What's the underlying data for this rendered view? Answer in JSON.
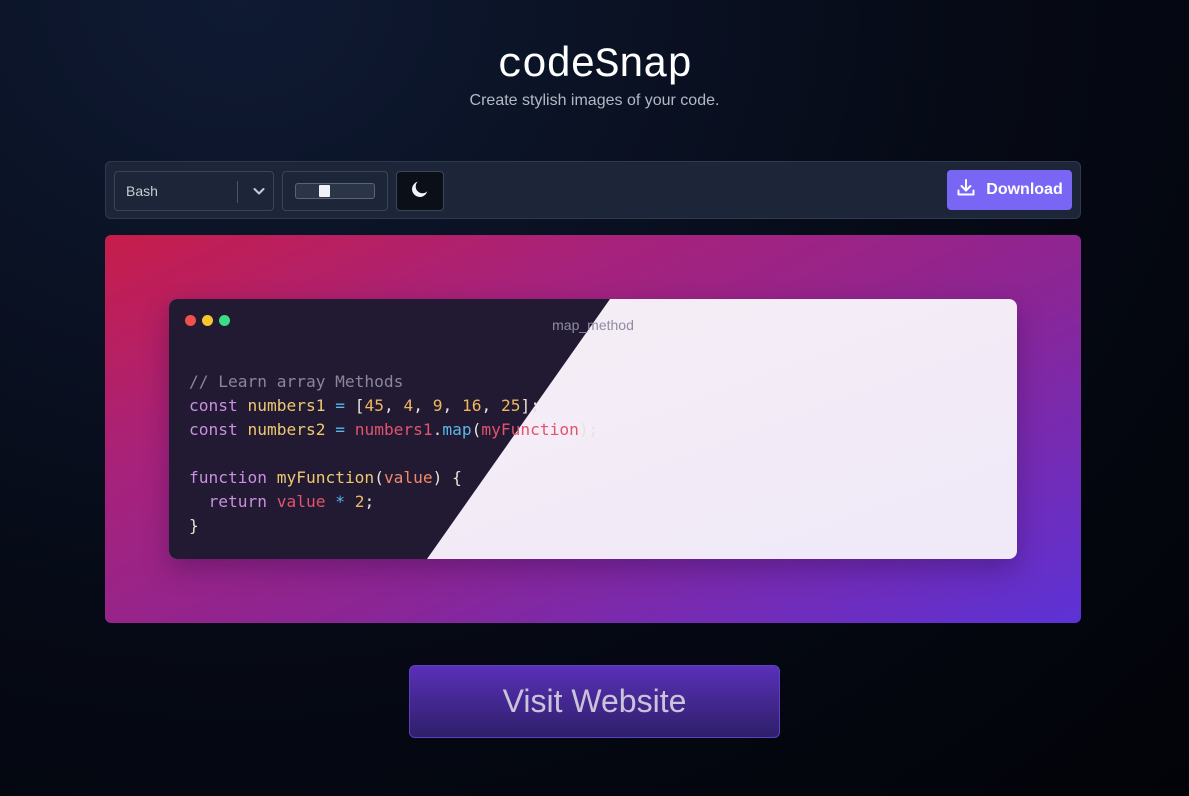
{
  "app": {
    "title": "codeSnap",
    "subtitle": "Create stylish images of your code."
  },
  "toolbar": {
    "language": {
      "selected": "Bash",
      "icon": "chevron-down-icon"
    },
    "padding_slider": {
      "value_fraction": 0.35
    },
    "theme_toggle": {
      "icon": "moon-icon"
    },
    "download": {
      "label": "Download",
      "icon": "download-icon"
    }
  },
  "code_window": {
    "file_name": "map_method",
    "dots": [
      "#f2504b",
      "#f7c52d",
      "#3ddc84"
    ],
    "lines": [
      [
        {
          "t": "// Learn array Methods",
          "c": "comment"
        }
      ],
      [
        {
          "t": "const ",
          "c": "kw"
        },
        {
          "t": "numbers1",
          "c": "var"
        },
        {
          "t": " = ",
          "c": "op"
        },
        {
          "t": "[",
          "c": "plain"
        },
        {
          "t": "45",
          "c": "num"
        },
        {
          "t": ", ",
          "c": "plain"
        },
        {
          "t": "4",
          "c": "num"
        },
        {
          "t": ", ",
          "c": "plain"
        },
        {
          "t": "9",
          "c": "num"
        },
        {
          "t": ", ",
          "c": "plain"
        },
        {
          "t": "16",
          "c": "num"
        },
        {
          "t": ", ",
          "c": "plain"
        },
        {
          "t": "25",
          "c": "num"
        },
        {
          "t": "];",
          "c": "plain"
        }
      ],
      [
        {
          "t": "const ",
          "c": "kw"
        },
        {
          "t": "numbers2",
          "c": "var"
        },
        {
          "t": " = ",
          "c": "op"
        },
        {
          "t": "numbers1",
          "c": "ref"
        },
        {
          "t": ".",
          "c": "plain"
        },
        {
          "t": "map",
          "c": "method"
        },
        {
          "t": "(",
          "c": "plain"
        },
        {
          "t": "myFunction",
          "c": "ref"
        },
        {
          "t": ");",
          "c": "plain"
        }
      ],
      [],
      [
        {
          "t": "function ",
          "c": "kw"
        },
        {
          "t": "myFunction",
          "c": "fn"
        },
        {
          "t": "(",
          "c": "plain"
        },
        {
          "t": "value",
          "c": "param"
        },
        {
          "t": ") {",
          "c": "plain"
        }
      ],
      [
        {
          "t": "  ",
          "c": "plain"
        },
        {
          "t": "return ",
          "c": "kw"
        },
        {
          "t": "value",
          "c": "ref"
        },
        {
          "t": " * ",
          "c": "op"
        },
        {
          "t": "2",
          "c": "num"
        },
        {
          "t": ";",
          "c": "plain"
        }
      ],
      [
        {
          "t": "}",
          "c": "plain"
        }
      ]
    ]
  },
  "visit_button": {
    "label": "Visit Website"
  }
}
